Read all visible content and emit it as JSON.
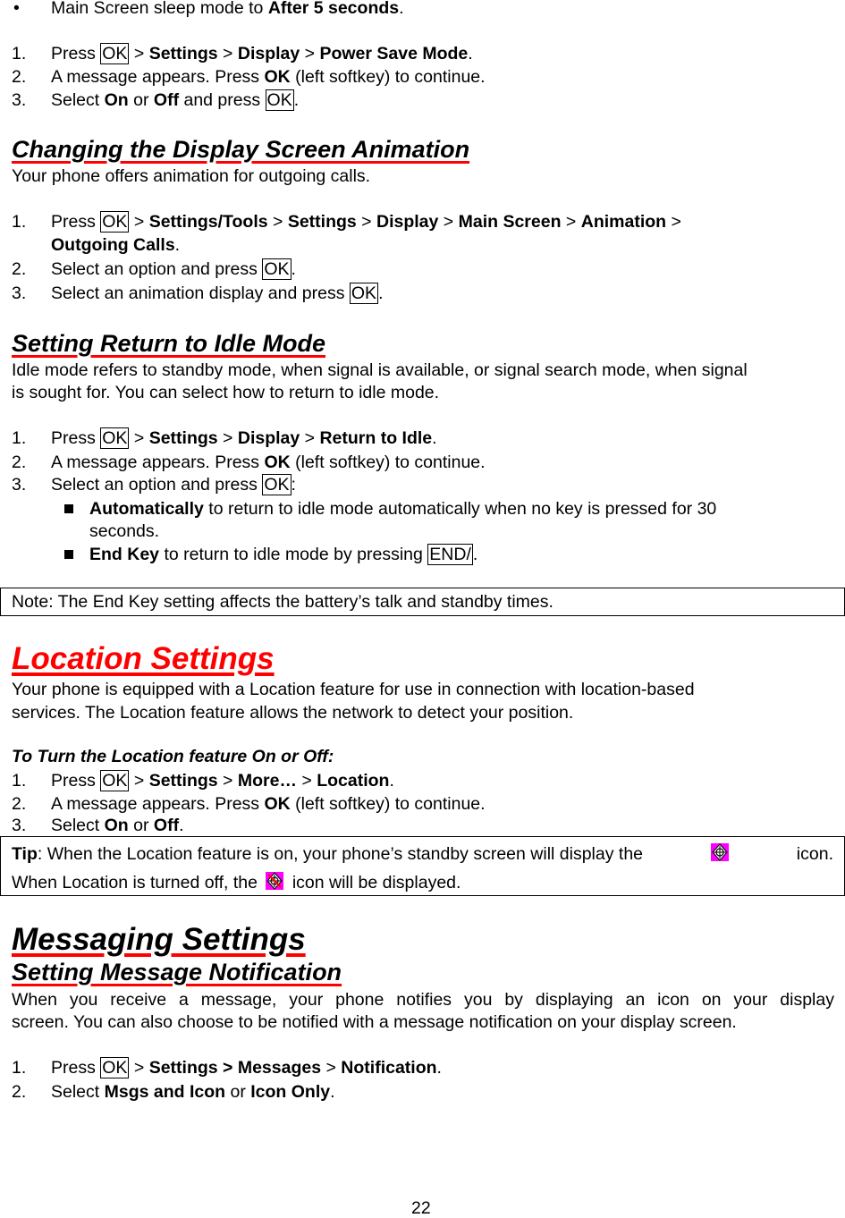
{
  "intro_bullet": {
    "pre": "Main Screen sleep mode to ",
    "bold": "After 5 seconds",
    "post": "."
  },
  "power_save": {
    "steps": [
      {
        "num": "1.",
        "press": "Press ",
        "key": "OK",
        "path": [
          " > ",
          "Settings",
          " > ",
          "Display",
          " > ",
          "Power Save Mode",
          "."
        ]
      },
      {
        "num": "2.",
        "pre": "A message appears. Press ",
        "bold": "OK",
        "post": " (left softkey) to continue."
      },
      {
        "num": "3.",
        "pre": "Select ",
        "b1": "On",
        "mid": " or ",
        "b2": "Off",
        "post": " and press ",
        "key": "OK",
        "end": "."
      }
    ]
  },
  "animation": {
    "heading": "Changing the Display Screen Animation",
    "intro": "Your phone offers animation for outgoing calls.",
    "steps": [
      {
        "num": "1.",
        "press": "Press ",
        "key": "OK",
        "line1": [
          " > ",
          "Settings/Tools",
          " > ",
          "Settings",
          " > ",
          "Display",
          " > ",
          "Main Screen",
          " > ",
          "Animation",
          " >"
        ],
        "line2_bold": "Outgoing Calls",
        "line2_end": "."
      },
      {
        "num": "2.",
        "pre": "Select an option and press ",
        "key": "OK",
        "end": "."
      },
      {
        "num": "3.",
        "pre": "Select an animation display and press ",
        "key": "OK",
        "end": "."
      }
    ]
  },
  "idle": {
    "heading": "Setting Return to Idle Mode",
    "intro_line1": "Idle mode refers to standby mode, when signal is available, or signal search mode, when signal",
    "intro_line2": "is sought for. You can select how to return to idle mode.",
    "steps": [
      {
        "num": "1.",
        "press": "Press ",
        "key": "OK",
        "path": [
          " > ",
          "Settings",
          " > ",
          "Display",
          " > ",
          "Return to Idle",
          "."
        ]
      },
      {
        "num": "2.",
        "pre": "A message appears. Press ",
        "bold": "OK",
        "post": " (left softkey) to continue."
      },
      {
        "num": "3.",
        "pre": "Select an option and press ",
        "key": "OK",
        "end": ":"
      }
    ],
    "options": [
      {
        "bold": "Automatically",
        "text": " to return to idle mode automatically when no key is pressed for 30",
        "text2": "seconds."
      },
      {
        "bold": "End Key",
        "text": " to return to idle mode by pressing ",
        "key": "END/",
        "end": "."
      }
    ],
    "note": "Note: The End Key setting affects the battery’s talk and standby times."
  },
  "location": {
    "heading": "Location Settings",
    "intro_line1": "Your phone is equipped with a Location feature for use in connection with location-based",
    "intro_line2": "services. The Location feature allows the network to detect your position.",
    "subheading": "To Turn the Location feature On or Off:",
    "steps": [
      {
        "num": "1.",
        "press": "Press ",
        "key": "OK",
        "path": [
          " > ",
          "Settings",
          " > ",
          "More…",
          " > ",
          "Location",
          "."
        ]
      },
      {
        "num": "2.",
        "pre": "A message appears. Press ",
        "bold": "OK",
        "post": " (left softkey) to continue."
      },
      {
        "num": "3.",
        "pre": "Select ",
        "b1": "On",
        "mid": " or ",
        "b2": "Off",
        "end": "."
      }
    ],
    "tip": {
      "label": "Tip",
      "line1": ": When the Location feature is on, your phone’s standby screen will display the",
      "line1_end": "icon.",
      "line2_pre": "When Location is turned off, the",
      "line2_post": "icon will be displayed.",
      "icon_on": "location-on-icon",
      "icon_off": "location-off-icon",
      "icon_bg": "#ff00ff"
    }
  },
  "messaging": {
    "heading": "Messaging Settings",
    "subheading": "Setting Message Notification",
    "intro_line1": "When you receive a message, your phone notifies you by displaying an icon on your display",
    "intro_line2": "screen. You can also choose to be notified with a message notification on your display screen.",
    "steps": [
      {
        "num": "1.",
        "press": "Press ",
        "key": "OK",
        "path": [
          " > ",
          "Settings > Messages",
          " > ",
          "Notification",
          "."
        ]
      },
      {
        "num": "2.",
        "pre": "Select ",
        "b1": "Msgs and Icon",
        "mid": " or ",
        "b2": "Icon Only",
        "end": "."
      }
    ]
  },
  "page_number": "22",
  "colors": {
    "heading_underline": "#ff0000",
    "location_heading": "#ff0000"
  }
}
